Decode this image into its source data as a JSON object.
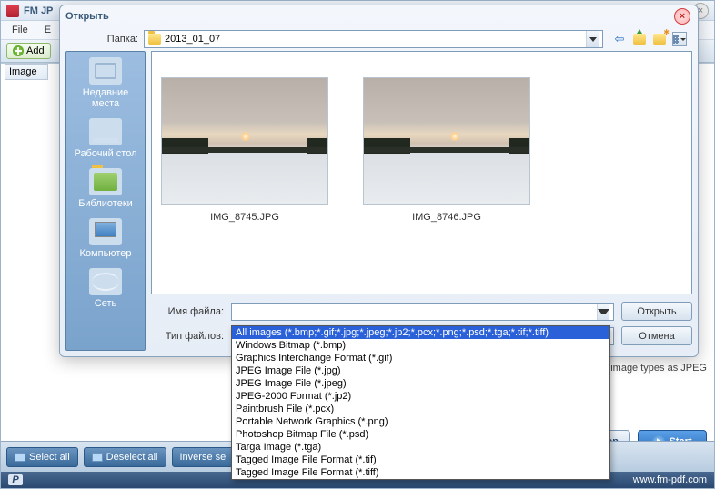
{
  "parent": {
    "title": "FM JP",
    "menu": {
      "file": "File",
      "edit": "E"
    },
    "add": "Add",
    "image_col": "Image",
    "note": "d all image types as JPEG",
    "open": "Open",
    "start": "Start",
    "select_all": "Select all",
    "deselect_all": "Deselect all",
    "inverse": "Inverse sel",
    "url": "www.fm-pdf.com"
  },
  "dialog": {
    "title": "Открыть",
    "folder_label": "Папка:",
    "folder_value": "2013_01_07",
    "places": {
      "recent": "Недавние места",
      "desktop": "Рабочий стол",
      "libraries": "Библиотеки",
      "computer": "Компьютер",
      "network": "Сеть"
    },
    "files": [
      {
        "name": "IMG_8745.JPG"
      },
      {
        "name": "IMG_8746.JPG"
      }
    ],
    "filename_label": "Имя файла:",
    "filename_value": "",
    "filetype_label": "Тип файлов:",
    "filetype_value": "All images (*.bmp;*.gif;*.jpg;*.jpeg;*.jp2;*.pcx;*.png;*.psd;*.tga;*.tif;*.tiff)",
    "open_btn": "Открыть",
    "cancel_btn": "Отмена",
    "filetype_options": [
      "All images (*.bmp;*.gif;*.jpg;*.jpeg;*.jp2;*.pcx;*.png;*.psd;*.tga;*.tif;*.tiff)",
      "Windows Bitmap (*.bmp)",
      "Graphics Interchange Format (*.gif)",
      "JPEG Image File (*.jpg)",
      "JPEG Image File (*.jpeg)",
      "JPEG-2000 Format (*.jp2)",
      "Paintbrush File (*.pcx)",
      "Portable Network Graphics (*.png)",
      "Photoshop Bitmap File (*.psd)",
      "Targa Image (*.tga)",
      "Tagged Image File Format (*.tif)",
      "Tagged Image File Format (*.tiff)"
    ]
  }
}
